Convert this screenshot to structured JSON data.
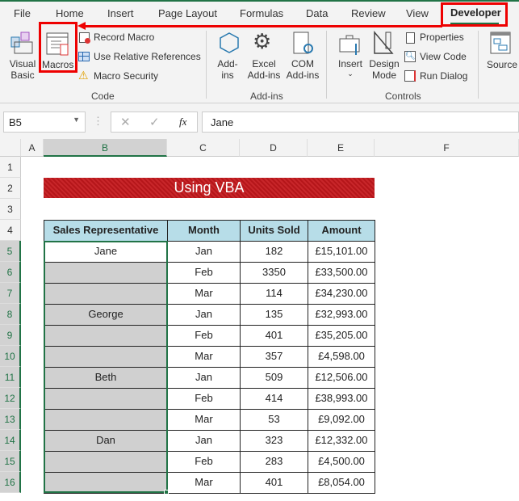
{
  "tabs": [
    "File",
    "Home",
    "Insert",
    "Page Layout",
    "Formulas",
    "Data",
    "Review",
    "View",
    "Developer"
  ],
  "ribbon": {
    "visual_basic": [
      "Visual",
      "Basic"
    ],
    "macros": "Macros",
    "record_macro": "Record Macro",
    "relative_refs": "Use Relative References",
    "macro_security": "Macro Security",
    "group_code": "Code",
    "addins": [
      "Add-",
      "ins"
    ],
    "excel_addins": [
      "Excel",
      "Add-ins"
    ],
    "com_addins": [
      "COM",
      "Add-ins"
    ],
    "group_addins": "Add-ins",
    "insert": "Insert",
    "design_mode": [
      "Design",
      "Mode"
    ],
    "properties": "Properties",
    "view_code": "View Code",
    "run_dialog": "Run Dialog",
    "group_controls": "Controls",
    "source": "Source"
  },
  "formula_bar": {
    "name_box": "B5",
    "fx": "fx",
    "value": "Jane"
  },
  "columns": [
    "A",
    "B",
    "C",
    "D",
    "E",
    "F"
  ],
  "rows": [
    "1",
    "2",
    "3",
    "4",
    "5",
    "6",
    "7",
    "8",
    "9",
    "10",
    "11",
    "12",
    "13",
    "14",
    "15",
    "16"
  ],
  "banner": "Using VBA",
  "table": {
    "headers": [
      "Sales Representative",
      "Month",
      "Units Sold",
      "Amount"
    ],
    "rows": [
      [
        "Jane",
        "Jan",
        "182",
        "£15,101.00"
      ],
      [
        "",
        "Feb",
        "3350",
        "£33,500.00"
      ],
      [
        "",
        "Mar",
        "114",
        "£34,230.00"
      ],
      [
        "George",
        "Jan",
        "135",
        "£32,993.00"
      ],
      [
        "",
        "Feb",
        "401",
        "£35,205.00"
      ],
      [
        "",
        "Mar",
        "357",
        "£4,598.00"
      ],
      [
        "Beth",
        "Jan",
        "509",
        "£12,506.00"
      ],
      [
        "",
        "Feb",
        "414",
        "£38,993.00"
      ],
      [
        "",
        "Mar",
        "53",
        "£9,092.00"
      ],
      [
        "Dan",
        "Jan",
        "323",
        "£12,332.00"
      ],
      [
        "",
        "Feb",
        "283",
        "£4,500.00"
      ],
      [
        "",
        "Mar",
        "401",
        "£8,054.00"
      ]
    ]
  }
}
